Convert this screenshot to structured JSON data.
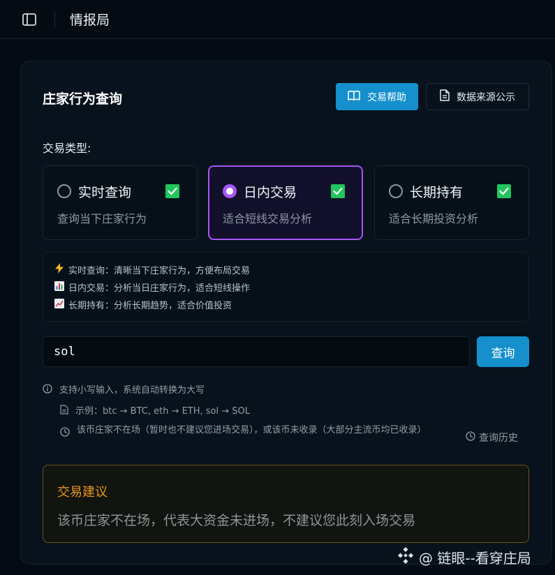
{
  "app": {
    "title": "情报局"
  },
  "card": {
    "title": "庄家行为查询",
    "help_button": "交易帮助",
    "source_button": "数据来源公示"
  },
  "trade_type": {
    "label": "交易类型:",
    "options": [
      {
        "title": "实时查询",
        "desc": "查询当下庄家行为",
        "selected": false,
        "checked": true
      },
      {
        "title": "日内交易",
        "desc": "适合短线交易分析",
        "selected": true,
        "checked": true
      },
      {
        "title": "长期持有",
        "desc": "适合长期投资分析",
        "selected": false,
        "checked": true
      }
    ]
  },
  "info": {
    "lines": [
      {
        "icon": "lightning-icon",
        "text": "实时查询：清晰当下庄家行为，方便布局交易"
      },
      {
        "icon": "bar-chart-icon",
        "text": "日内交易：分析当日庄家行为，适合短线操作"
      },
      {
        "icon": "trend-chart-icon",
        "text": "长期持有：分析长期趋势，适合价值投资"
      }
    ]
  },
  "search": {
    "value": "sol",
    "button": "查询"
  },
  "hints": {
    "case_hint": "支持小写输入，系统自动转换为大写",
    "example": "示例：btc → BTC, eth → ETH, sol → SOL",
    "status": "该币庄家不在场（暂时也不建议您进场交易），或该币未收录（大部分主流币均已收录）",
    "history": "查询历史"
  },
  "advice": {
    "title": "交易建议",
    "text": "该币庄家不在场，代表大资金未进场，不建议您此刻入场交易"
  },
  "watermark": {
    "text": "@ 链眼--看穿庄局"
  },
  "colors": {
    "accent_blue": "#1590cd",
    "accent_purple": "#a855f7",
    "check_green": "#22c55e",
    "advice_orange": "#e8941d"
  }
}
